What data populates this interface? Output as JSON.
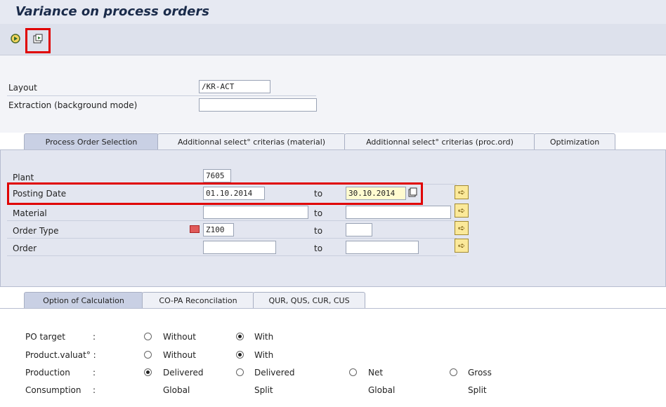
{
  "title": "Variance on process orders",
  "toolbar": {
    "execute_icon": "execute-icon",
    "variant_icon": "get-variant-icon"
  },
  "top": {
    "layout_label": "Layout",
    "layout_value": "/KR-ACT",
    "extraction_label": "Extraction (background mode)",
    "extraction_value": ""
  },
  "tabs1": [
    "Process Order Selection",
    "Additionnal select° criterias (material)",
    "Additionnal select° criterias (proc.ord)",
    "Optimization"
  ],
  "selection": {
    "plant_label": "Plant",
    "plant_value": "7605",
    "posting_label": "Posting Date",
    "posting_from": "01.10.2014",
    "posting_to": "30.10.2014",
    "material_label": "Material",
    "material_from": "",
    "material_to": "",
    "ordertype_label": "Order Type",
    "ordertype_from": "Z100",
    "ordertype_to": "",
    "order_label": "Order",
    "order_from": "",
    "order_to": "",
    "to_label": "to"
  },
  "tabs2": [
    "Option of Calculation",
    "CO-PA Reconcilation",
    "QUR, QUS, CUR, CUS"
  ],
  "calc": {
    "po_target_label": "PO target",
    "colon": ":",
    "product_label": "Product.valuat° :",
    "production_label": "Production",
    "consumption_label": "Consumption",
    "without": "Without",
    "with": "With",
    "delivered": "Delivered",
    "net": "Net",
    "gross": "Gross",
    "global": "Global",
    "split": "Split"
  },
  "colors": {
    "accent_red": "#e00000",
    "panel": "#e3e6f0"
  }
}
